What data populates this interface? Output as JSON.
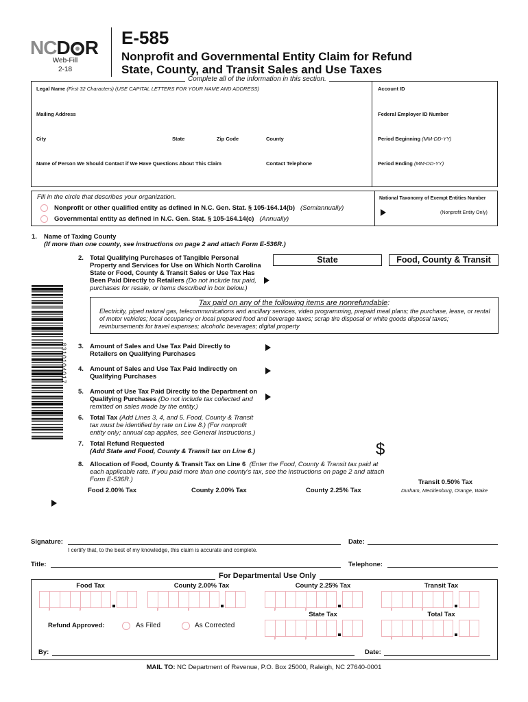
{
  "header": {
    "logo_left": "NC",
    "logo_right": "DOR",
    "web_fill": "Web-Fill",
    "revision": "2-18",
    "form_number": "E-585",
    "title_line1": "Nonprofit and Governmental Entity Claim for Refund",
    "title_line2": "State, County, and Transit Sales and Use Taxes"
  },
  "info_section": {
    "instruction": "Complete all of the information in this section.",
    "legal_name_label": "Legal Name",
    "legal_name_note": "(First 32 Characters) (USE CAPITAL LETTERS FOR YOUR NAME AND ADDRESS)",
    "mailing_address_label": "Mailing Address",
    "city_label": "City",
    "state_label": "State",
    "zip_label": "Zip Code",
    "county_label": "County",
    "contact_name_label": "Name of Person We Should Contact if We Have Questions About This Claim",
    "contact_phone_label": "Contact Telephone",
    "account_id_label": "Account ID",
    "fein_label": "Federal Employer  ID Number",
    "period_begin_label": "Period Beginning",
    "period_begin_format": "(MM-DD-YY)",
    "period_end_label": "Period Ending",
    "period_end_format": "(MM-DD-YY)",
    "values": {
      "legal_name": "",
      "mailing_address": "",
      "city": "",
      "state": "",
      "zip": "",
      "county": "",
      "contact_name": "",
      "contact_phone": "",
      "account_id": "",
      "fein": "",
      "period_begin": "",
      "period_end": ""
    }
  },
  "organization": {
    "instruction": "Fill in the circle that describes your organization.",
    "options": [
      {
        "label": "Nonprofit or other qualified entity as defined in N.C. Gen. Stat. § 105-164.14(b)",
        "note": "(Semiannually)",
        "selected": false
      },
      {
        "label": "Governmental entity as defined in N.C. Gen. Stat. § 105-164.14(c)",
        "note": "(Annually)",
        "selected": false
      }
    ],
    "ntee_label": "National Taxonomy of Exempt Entities Number",
    "ntee_note": "(Nonprofit Entity Only)",
    "ntee_value": ""
  },
  "lines": {
    "l1_num": "1.",
    "l1_title": "Name of Taxing County",
    "l1_note": "(If more than one county, see instructions on page 2 and attach Form E-536R.)",
    "l2_num": "2.",
    "l2_title": "Total Qualifying Purchases of Tangible Personal Property and Services for Use on Which North Carolina State or Food, County & Transit Sales or Use Tax Has Been Paid Directly to Retailers",
    "l2_note": "(Do not include tax paid, purchases for resale, or items described in box below.)",
    "col_state": "State",
    "col_fct": "Food, County & Transit",
    "nonref_title": "Tax paid on any of the following items are nonrefundable",
    "nonref_colon": ":",
    "nonref_body": "Electricity, piped natural gas, telecommunications and ancillary services, video programming, prepaid meal plans;  the purchase, lease, or rental of motor vehicles;  local occupancy or local prepared food and beverage taxes;  scrap tire disposal or white goods disposal taxes;  reimbursements for travel expenses;  alcoholic beverages;  digital property",
    "l3_num": "3.",
    "l3_title": "Amount of Sales and Use Tax Paid Directly to Retailers on Qualifying Purchases",
    "l4_num": "4.",
    "l4_title": "Amount of Sales and Use Tax Paid Indirectly on Qualifying Purchases",
    "l5_num": "5.",
    "l5_title": "Amount of Use Tax Paid Directly to the Department on Qualifying Purchases",
    "l5_note": "(Do not include tax collected and remitted on sales made by the entity.)",
    "l6_num": "6.",
    "l6_title": "Total Tax",
    "l6_note": "(Add Lines 3, 4, and 5.  Food, County & Transit tax must be identified by rate on Line 8.)  (For nonprofit entity only; annual cap applies, see General Instructions.)",
    "l7_num": "7.",
    "l7_title": "Total Refund Requested",
    "l7_note": "(Add State and Food, County & Transit tax on Line 6.)",
    "currency_symbol": "$",
    "l8_num": "8.",
    "l8_title": "Allocation of Food, County & Transit Tax on Line 6",
    "l8_note": "(Enter the Food, County & Transit tax paid at each applicable rate. If you paid more than one county's tax, see the instructions on page 2 and attach Form E-536R.)",
    "alloc": {
      "food": "Food 2.00% Tax",
      "county200": "County 2.00% Tax",
      "county225": "County 2.25% Tax",
      "transit": "Transit 0.50% Tax",
      "transit_counties": "Durham, Mecklenburg, Orange, Wake"
    }
  },
  "barcode": {
    "number": "8310104017"
  },
  "signature": {
    "signature_label": "Signature:",
    "date_label": "Date:",
    "certify": "I certify that, to the best of my knowledge, this claim is accurate and complete.",
    "title_label": "Title:",
    "telephone_label": "Telephone:"
  },
  "departmental": {
    "title": "For Departmental Use Only",
    "food_tax": "Food Tax",
    "county200": "County 2.00% Tax",
    "county225": "County 2.25% Tax",
    "transit_tax": "Transit Tax",
    "state_tax": "State Tax",
    "total_tax": "Total Tax",
    "refund_approved": "Refund Approved:",
    "as_filed": "As Filed",
    "as_corrected": "As Corrected",
    "by_label": "By:",
    "date_label": "Date:"
  },
  "footer": {
    "mail_to_label": "MAIL TO:",
    "mail_to_address": "NC Department of Revenue, P.O. Box 25000, Raleigh, NC 27640-0001"
  }
}
